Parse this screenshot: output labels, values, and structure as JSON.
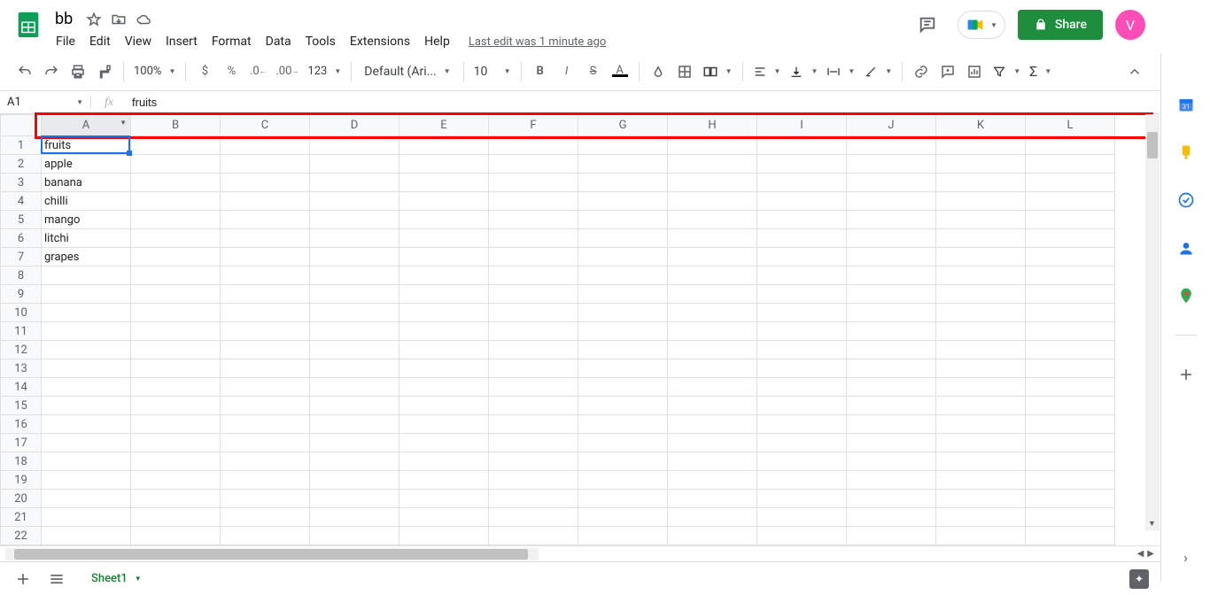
{
  "doc": {
    "title": "bb"
  },
  "menubar": {
    "items": [
      "File",
      "Edit",
      "View",
      "Insert",
      "Format",
      "Data",
      "Tools",
      "Extensions",
      "Help"
    ]
  },
  "lastEdit": "Last edit was 1 minute ago",
  "share": {
    "label": "Share"
  },
  "avatar": {
    "initial": "V"
  },
  "toolbar": {
    "zoom": "100%",
    "numfmt": "123",
    "font": "Default (Ari...",
    "fontSize": "10"
  },
  "namebox": "A1",
  "formula": "fruits",
  "columns": [
    "A",
    "B",
    "C",
    "D",
    "E",
    "F",
    "G",
    "H",
    "I",
    "J",
    "K",
    "L"
  ],
  "rowCount": 22,
  "cells": {
    "1": {
      "A": "fruits"
    },
    "2": {
      "A": "apple"
    },
    "3": {
      "A": "banana"
    },
    "4": {
      "A": "chilli"
    },
    "5": {
      "A": "mango"
    },
    "6": {
      "A": "litchi"
    },
    "7": {
      "A": "grapes"
    }
  },
  "sheetTab": "Sheet1"
}
